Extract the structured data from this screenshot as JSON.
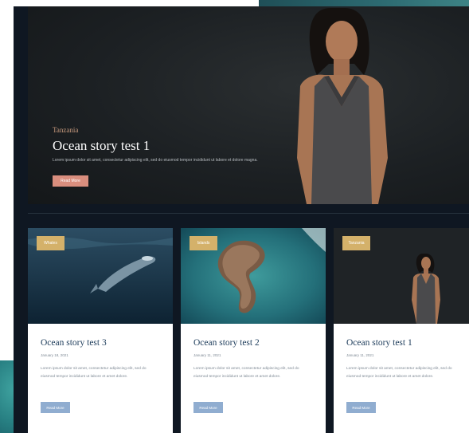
{
  "hero": {
    "category": "Tanzania",
    "title": "Ocean story test 1",
    "excerpt": "Lorem ipsum dolor sit amet, consectetur adipiscing elit, sed do eiusmod tempor incididunt ut labore et dolore magna.",
    "button_label": "Read More"
  },
  "cards": [
    {
      "badge": "Whales",
      "title": "Ocean story test 3",
      "date": "January 18, 2021",
      "excerpt": "Lorem ipsum dolor sit amet, consectetur adipiscing elit, sed do eiusmod tempor incididunt ut labore et amet dolore.",
      "button_label": "Read More"
    },
    {
      "badge": "Islands",
      "title": "Ocean story test 2",
      "date": "January 11, 2021",
      "excerpt": "Lorem ipsum dolor sit amet, consectetur adipiscing elit, sed do eiusmod tempor incididunt ut labore et amet dolore.",
      "button_label": "Read More"
    },
    {
      "badge": "Tanzania",
      "title": "Ocean story test 1",
      "date": "January 11, 2021",
      "excerpt": "Lorem ipsum dolor sit amet, consectetur adipiscing elit, sed do eiusmod tempor incididunt ut labore et amet dolore.",
      "button_label": "Read More"
    }
  ],
  "colors": {
    "background_dark": "#0f1722",
    "hero_accent": "#d98e7e",
    "badge": "#d4b16a",
    "card_title": "#1c3b5a",
    "card_button": "#90add0"
  },
  "icons": [
    "hero-person-photo",
    "whale-photo",
    "island-photo",
    "person-photo"
  ]
}
